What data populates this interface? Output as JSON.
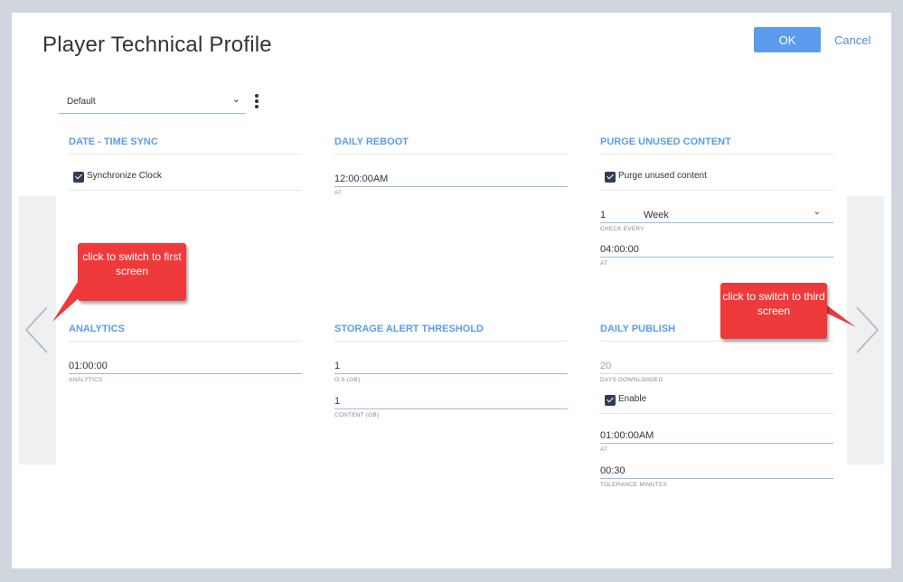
{
  "dialog": {
    "title": "Player Technical Profile",
    "ok_label": "OK",
    "cancel_label": "Cancel",
    "accent_color": "#5b9cec"
  },
  "profile": {
    "selected": "Default"
  },
  "sections": {
    "date_time_sync": {
      "title": "DATE - TIME SYNC",
      "checkbox_label": "Synchronize Clock",
      "checked": true
    },
    "daily_reboot": {
      "title": "DAILY REBOOT",
      "at_value": "12:00:00AM",
      "at_label": "AT"
    },
    "purge_unused_content": {
      "title": "PURGE UNUSED CONTENT",
      "checkbox_label": "Purge unused content",
      "checked": true,
      "check_every_value": "1",
      "check_every_unit": "Week",
      "check_every_label": "CHECK EVERY",
      "at_value": "04:00:00",
      "at_label": "AT"
    },
    "analytics": {
      "title": "ANALYTICS",
      "value": "01:00:00",
      "label": "ANALYTICS"
    },
    "storage_alert_threshold": {
      "title": "STORAGE ALERT THRESHOLD",
      "os_value": "1",
      "os_label": "O.S (GB)",
      "content_value": "1",
      "content_label": "CONTENT (GB)"
    },
    "daily_publish": {
      "title": "DAILY PUBLISH",
      "days_downloaded_value": "20",
      "days_downloaded_label": "DAYS DOWNLOADED",
      "enable_label": "Enable",
      "enabled": true,
      "at_value": "01:00:00AM",
      "at_label": "AT",
      "tolerance_value": "00:30",
      "tolerance_label": "TOLERANCE MINUTES"
    }
  },
  "callouts": {
    "left": "click to switch to first screen",
    "right": "click to switch to third screen",
    "color": "#ee3a3b"
  }
}
